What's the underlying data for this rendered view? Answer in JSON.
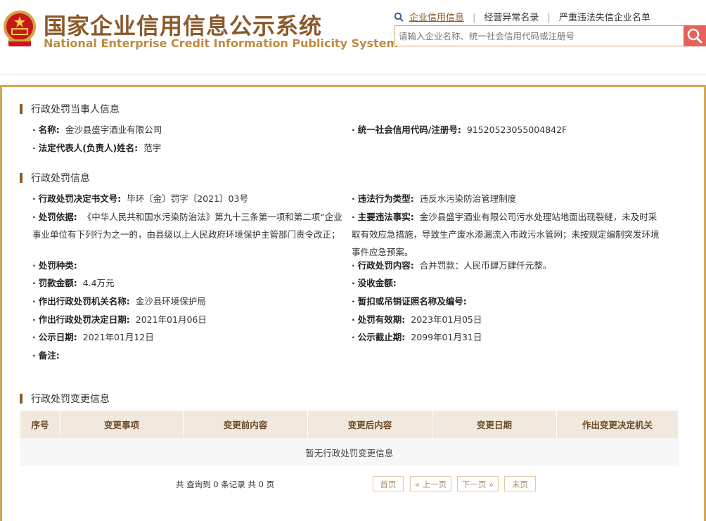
{
  "header": {
    "title_cn": "国家企业信用信息公示系统",
    "title_en": "National Enterprise Credit Information Publicity System",
    "links": [
      "企业信用信息",
      "经营异常名录",
      "严重违法失信企业名单"
    ],
    "search_placeholder": "请输入企业名称、统一社会信用代码或注册号",
    "accent_color": "#8a5a2b",
    "search_button_color": "#e8625c"
  },
  "party": {
    "section_title": "行政处罚当事人信息",
    "name_label": "名称:",
    "name_value": "金沙县盛宇酒业有限公司",
    "credit_code_label": "统一社会信用代码/注册号:",
    "credit_code_value": "91520523055004842F",
    "legal_rep_label": "法定代表人(负责人)姓名:",
    "legal_rep_value": "范宇"
  },
  "penalty": {
    "section_title": "行政处罚信息",
    "doc_no_label": "行政处罚决定书文号:",
    "doc_no_value": "毕环〔金〕罚字〔2021〕03号",
    "violation_type_label": "违法行为类型:",
    "violation_type_value": "违反水污染防治管理制度",
    "basis_label": "处罚依据:",
    "basis_value": "《中华人民共和国水污染防治法》第九十三条第一项和第二项“企业事业单位有下列行为之一的，由县级以上人民政府环境保护主管部门责令改正；",
    "facts_label": "主要违法事实:",
    "facts_value": "金沙县盛宇酒业有限公司污水处理站地面出现裂缝，未及时采取有效应急措施，导致生产废水渗漏流入市政污水管网；未按规定编制突发环境事件应急预案。",
    "category_label": "处罚种类:",
    "category_value": "",
    "content_label": "行政处罚内容:",
    "content_value": "合并罚款：人民币肆万肆仟元整。",
    "fine_label": "罚款金额:",
    "fine_value": "4.4万元",
    "confiscation_label": "没收金额:",
    "confiscation_value": "",
    "authority_label": "作出行政处罚机关名称:",
    "authority_value": "金沙县环境保护局",
    "license_label": "暂扣或吊销证照名称及编号:",
    "license_value": "",
    "decision_date_label": "作出行政处罚决定日期:",
    "decision_date_value": "2021年01月06日",
    "valid_label": "处罚有效期:",
    "valid_value": "2023年01月05日",
    "publish_date_label": "公示日期:",
    "publish_date_value": "2021年01月12日",
    "publish_end_label": "公示截止期:",
    "publish_end_value": "2099年01月31日",
    "remark_label": "备注:",
    "remark_value": ""
  },
  "changes": {
    "section_title": "行政处罚变更信息",
    "columns": [
      "序号",
      "变更事项",
      "变更前内容",
      "变更后内容",
      "变更日期",
      "作出变更决定机关"
    ],
    "empty_text": "暂无行政处罚变更信息",
    "pager_info": "共 查询到 0 条记录 共 0 页",
    "first_label": "首页",
    "prev_label": "« 上一页",
    "next_label": "下一页 »",
    "last_label": "末页"
  }
}
